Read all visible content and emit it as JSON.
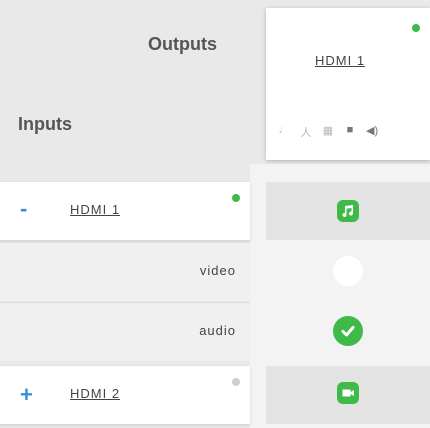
{
  "header": {
    "outputs_label": "Outputs",
    "inputs_label": "Inputs"
  },
  "output": {
    "name": "HDMI 1",
    "status_color": "#3fb948",
    "icons": [
      "music-note-icon",
      "person-icon",
      "grid-icon",
      "video-camera-icon",
      "speaker-icon"
    ]
  },
  "inputs": [
    {
      "sign": "-",
      "name": "HDMI 1",
      "status_color": "#3fb948",
      "route_icon": "music-note-icon"
    },
    {
      "sign": "+",
      "name": "HDMI 2",
      "status_color": "#cfcfcf",
      "route_icon": "video-camera-icon"
    }
  ],
  "sub_rows": [
    {
      "label": "video",
      "route_state": "empty"
    },
    {
      "label": "audio",
      "route_state": "checked"
    }
  ],
  "colors": {
    "accent_blue": "#3b8dd6",
    "green": "#3fb948",
    "background": "#e9e9e9"
  }
}
